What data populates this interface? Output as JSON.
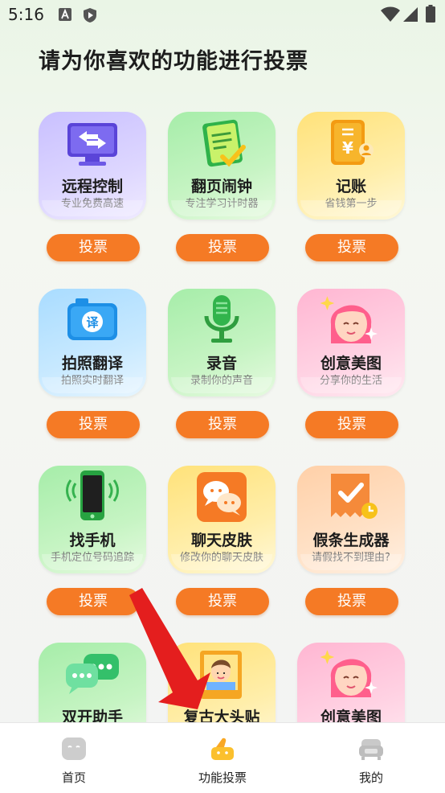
{
  "status_bar": {
    "time": "5:16"
  },
  "page": {
    "title": "请为你喜欢的功能进行投票"
  },
  "vote_label": "投票",
  "cards": [
    {
      "title": "远程控制",
      "subtitle": "专业免费高速",
      "icon": "remote-monitor-icon",
      "color": "#c9c0ff"
    },
    {
      "title": "翻页闹钟",
      "subtitle": "专注学习计时器",
      "icon": "notepad-check-icon",
      "color": "#a6eda9"
    },
    {
      "title": "记账",
      "subtitle": "省钱第一步",
      "icon": "yen-receipt-icon",
      "color": "#ffe27a"
    },
    {
      "title": "拍照翻译",
      "subtitle": "拍照实时翻译",
      "icon": "camera-translate-icon",
      "color": "#a9dcff"
    },
    {
      "title": "录音",
      "subtitle": "录制你的声音",
      "icon": "microphone-icon",
      "color": "#a6eda9"
    },
    {
      "title": "创意美图",
      "subtitle": "分享你的生活",
      "icon": "girl-face-icon",
      "color": "#ffb6d2"
    },
    {
      "title": "找手机",
      "subtitle": "手机定位号码追踪",
      "icon": "ringing-phone-icon",
      "color": "#a6eda9"
    },
    {
      "title": "聊天皮肤",
      "subtitle": "修改你的聊天皮肤",
      "icon": "chat-bubbles-icon",
      "color": "#ffe27a"
    },
    {
      "title": "假条生成器",
      "subtitle": "请假找不到理由?",
      "icon": "leave-note-icon",
      "color": "#ffd0a8"
    },
    {
      "title": "双开助手",
      "subtitle": "",
      "icon": "chat-dual-icon",
      "color": "#a6eda9"
    },
    {
      "title": "复古大头贴",
      "subtitle": "",
      "icon": "photo-portrait-icon",
      "color": "#ffe27a"
    },
    {
      "title": "创意美图",
      "subtitle": "",
      "icon": "girl-face-icon",
      "color": "#ffb6d2"
    }
  ],
  "bottom_nav": [
    {
      "label": "首页",
      "icon": "home-robot-icon"
    },
    {
      "label": "功能投票",
      "icon": "thumbs-up-icon",
      "active": true
    },
    {
      "label": "我的",
      "icon": "sofa-icon"
    }
  ]
}
